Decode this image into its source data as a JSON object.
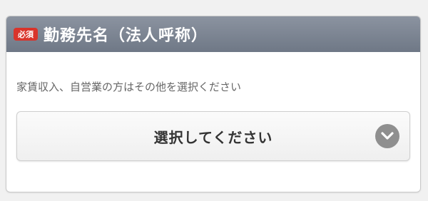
{
  "field": {
    "required_badge": "必須",
    "title": "勤務先名（法人呼称）",
    "note": "家賃収入、自営業の方はその他を選択ください",
    "select_value": "選択してください"
  },
  "icons": {
    "dropdown": "chevron-down-icon"
  },
  "colors": {
    "header_bg": "#7d8593",
    "required_badge": "#d9342b",
    "chevron_bg": "#8f8f8f"
  }
}
